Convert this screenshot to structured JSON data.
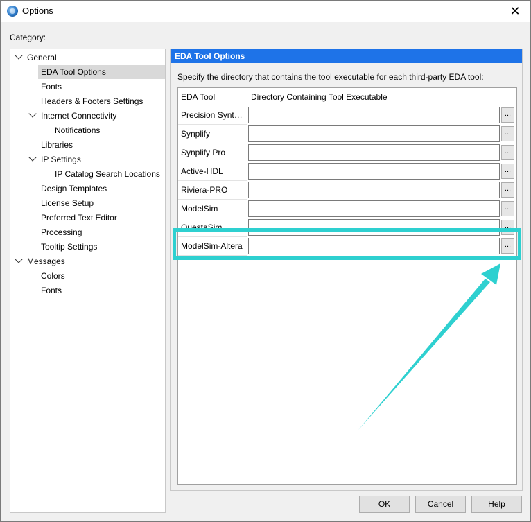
{
  "window": {
    "title": "Options",
    "close_glyph": "✕"
  },
  "category_label": "Category:",
  "tree": {
    "items": [
      {
        "label": "General",
        "expanded": true
      },
      {
        "label": "EDA Tool Options",
        "selected": true
      },
      {
        "label": "Fonts"
      },
      {
        "label": "Headers & Footers Settings"
      },
      {
        "label": "Internet Connectivity",
        "expanded": true
      },
      {
        "label": "Notifications"
      },
      {
        "label": "Libraries"
      },
      {
        "label": "IP Settings",
        "expanded": true
      },
      {
        "label": "IP Catalog Search Locations"
      },
      {
        "label": "Design Templates"
      },
      {
        "label": "License Setup"
      },
      {
        "label": "Preferred Text Editor"
      },
      {
        "label": "Processing"
      },
      {
        "label": "Tooltip Settings"
      },
      {
        "label": "Messages",
        "expanded": true
      },
      {
        "label": "Colors"
      },
      {
        "label": "Fonts"
      }
    ]
  },
  "panel": {
    "header": "EDA Tool Options",
    "description": "Specify the directory that contains the tool executable for each third-party EDA tool:",
    "columns": [
      "EDA Tool",
      "Directory Containing Tool Executable"
    ],
    "browse_label": "...",
    "rows": [
      {
        "tool": "Precision Synthesis",
        "path": ""
      },
      {
        "tool": "Synplify",
        "path": ""
      },
      {
        "tool": "Synplify Pro",
        "path": ""
      },
      {
        "tool": "Active-HDL",
        "path": ""
      },
      {
        "tool": "Riviera-PRO",
        "path": ""
      },
      {
        "tool": "ModelSim",
        "path": ""
      },
      {
        "tool": "QuestaSim",
        "path": ""
      },
      {
        "tool": "ModelSim-Altera",
        "path": ""
      }
    ]
  },
  "buttons": {
    "ok": "OK",
    "cancel": "Cancel",
    "help": "Help"
  },
  "colors": {
    "header_blue": "#1e73e8",
    "annotation_cyan": "#2ed0d0"
  }
}
